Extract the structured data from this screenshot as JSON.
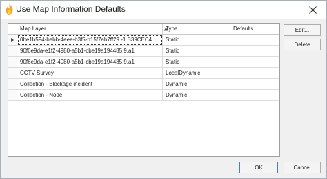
{
  "window": {
    "title": "Use Map Information Defaults"
  },
  "grid": {
    "columns": [
      "Map Layer",
      "Type",
      "Defaults"
    ],
    "rows": [
      {
        "map_layer": "0be1b594-bebb-4eee-b3f5-b15f7ab7ff29.-1.B39CEC4...",
        "type": "Static",
        "defaults": ""
      },
      {
        "map_layer": "90f6e9da-e1f2-4980-a5b1-cbe19a194485.9.a1",
        "type": "Static",
        "defaults": ""
      },
      {
        "map_layer": "90f6e9da-e1f2-4980-a5b1-cbe19a194485.9.a1",
        "type": "Static",
        "defaults": ""
      },
      {
        "map_layer": "CCTV Survey",
        "type": "LocalDynamic",
        "defaults": ""
      },
      {
        "map_layer": "Collection - Blockage incident",
        "type": "Dynamic",
        "defaults": ""
      },
      {
        "map_layer": "Collection - Node",
        "type": "Dynamic",
        "defaults": ""
      }
    ]
  },
  "side_buttons": {
    "edit": "Edit...",
    "delete": "Delete"
  },
  "footer_buttons": {
    "ok": "OK",
    "cancel": "Cancel"
  },
  "colors": {
    "accent": "#4a7cd0",
    "flame": "#f5a623"
  }
}
